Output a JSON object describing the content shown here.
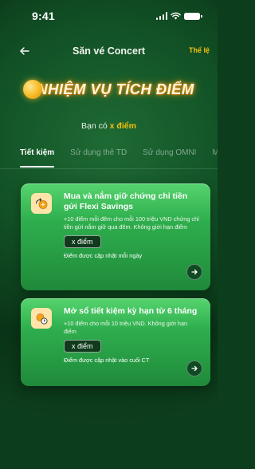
{
  "status_bar": {
    "time": "9:41"
  },
  "nav": {
    "title": "Săn vé Concert",
    "rules_link": "Thể lệ"
  },
  "banner": {
    "title": "NHIỆM VỤ TÍCH ĐIỂM"
  },
  "points": {
    "prefix": "Bạn có",
    "value": "x điểm"
  },
  "tabs": [
    {
      "label": "Tiết kiệm",
      "active": true
    },
    {
      "label": "Sử dụng thẻ TD",
      "active": false
    },
    {
      "label": "Sử dụng OMNI",
      "active": false
    },
    {
      "label": "M",
      "active": false
    }
  ],
  "tasks": [
    {
      "title": "Mua và nắm giữ chứng chỉ tiền gửi Flexi Savings",
      "description": "+10 điểm mỗi đêm cho mỗi 100 triệu VND chứng chỉ tiền gửi nắm giữ qua đêm. Không giới hạn điểm",
      "points_badge": "x điểm",
      "update_note": "Điểm được cập nhật mỗi ngày",
      "icon": "coin-exchange-icon"
    },
    {
      "title": "Mở sổ tiết kiệm kỳ hạn từ 6 tháng",
      "description": "+10 điểm cho mỗi 10 triệu VND. Không giới hạn điểm",
      "points_badge": "x điểm",
      "update_note": "Điểm được cập nhật vào cuối CT",
      "icon": "coin-clock-icon"
    }
  ],
  "colors": {
    "accent": "#f5c20c",
    "background": "#0c3d1c",
    "card": "#2fae4e",
    "badge": "#103a1c"
  }
}
